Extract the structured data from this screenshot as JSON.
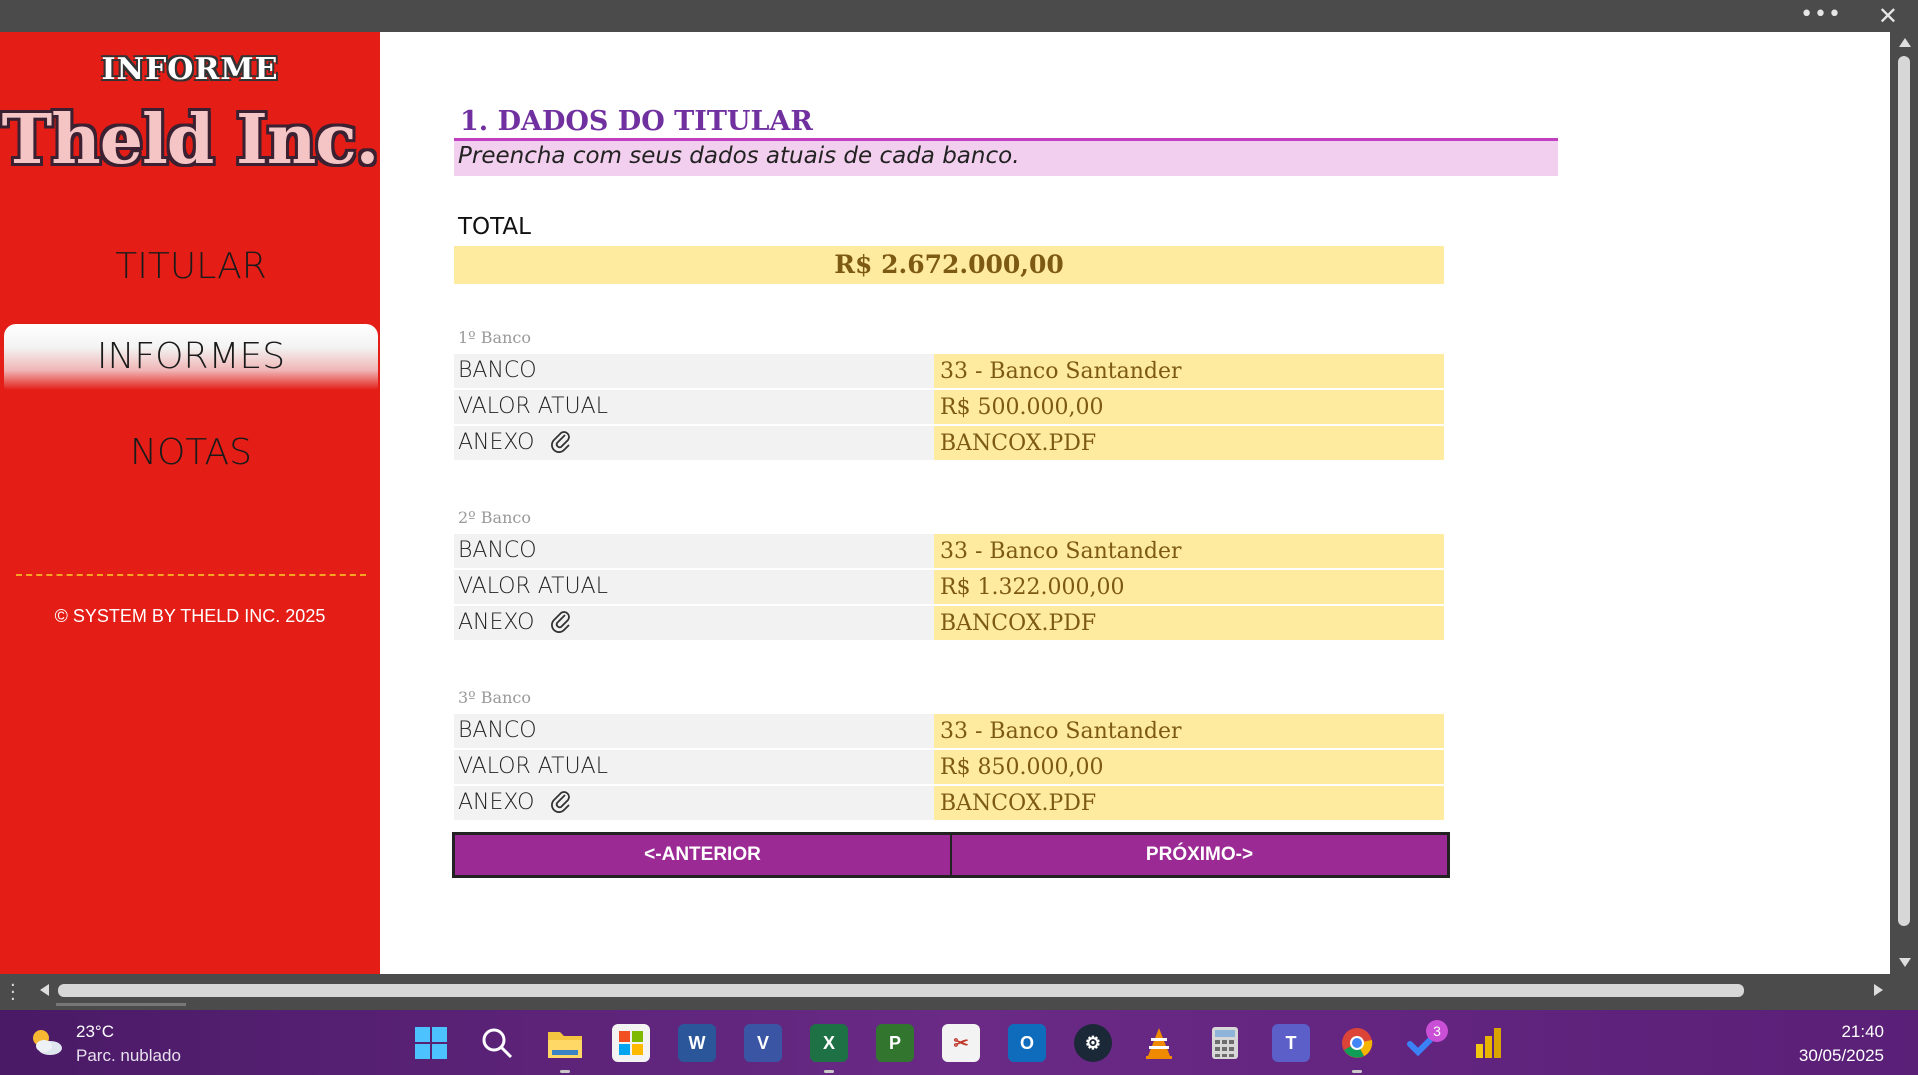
{
  "window": {
    "more_icon": "more-icon",
    "close_icon": "close-icon"
  },
  "sidebar": {
    "brand_top": "INFORME",
    "brand_main": "Theld Inc.",
    "items": [
      {
        "label": "TITULAR",
        "active": false
      },
      {
        "label": "INFORMES",
        "active": true
      },
      {
        "label": "NOTAS",
        "active": false
      }
    ],
    "copyright": "© SYSTEM BY THELD INC. 2025",
    "colors": {
      "background": "#e41e17",
      "divider": "#f6a623"
    }
  },
  "main": {
    "section_title": "1. DADOS DO TITULAR",
    "subtitle": "Preencha com seus dados atuais de cada banco.",
    "total_label": "TOTAL",
    "total_value": "R$ 2.672.000,00",
    "banks": [
      {
        "label": "1º Banco",
        "rows": [
          {
            "key": "BANCO",
            "value": "33 - Banco Santander"
          },
          {
            "key": "VALOR ATUAL",
            "value": "R$ 500.000,00"
          },
          {
            "key": "ANEXO",
            "value": "BANCOX.PDF",
            "icon": "paperclip-icon"
          }
        ]
      },
      {
        "label": "2º Banco",
        "rows": [
          {
            "key": "BANCO",
            "value": "33 - Banco Santander"
          },
          {
            "key": "VALOR ATUAL",
            "value": "R$ 1.322.000,00"
          },
          {
            "key": "ANEXO",
            "value": "BANCOX.PDF",
            "icon": "paperclip-icon"
          }
        ]
      },
      {
        "label": "3º Banco",
        "rows": [
          {
            "key": "BANCO",
            "value": "33 - Banco Santander"
          },
          {
            "key": "VALOR ATUAL",
            "value": "R$ 850.000,00"
          },
          {
            "key": "ANEXO",
            "value": "BANCOX.PDF",
            "icon": "paperclip-icon"
          }
        ]
      }
    ],
    "prev_label": "<-ANTERIOR",
    "next_label": "PRÓXIMO->",
    "colors": {
      "title": "#7030a0",
      "value_fill": "#ffeba0",
      "value_text": "#7d5a12",
      "button": "#9b2a95"
    }
  },
  "taskbar": {
    "weather_temp": "23°C",
    "weather_desc": "Parc. nublado",
    "time": "21:40",
    "date": "30/05/2025",
    "notification_badge": "3",
    "apps": [
      "windows-start-icon",
      "search-icon",
      "file-explorer-icon",
      "microsoft-store-icon",
      "word-icon",
      "visio-icon",
      "excel-icon",
      "project-icon",
      "snipping-tool-icon",
      "outlook-icon",
      "steam-icon",
      "vlc-icon",
      "calculator-icon",
      "teams-icon",
      "chrome-icon",
      "todo-icon",
      "power-bi-icon"
    ]
  }
}
